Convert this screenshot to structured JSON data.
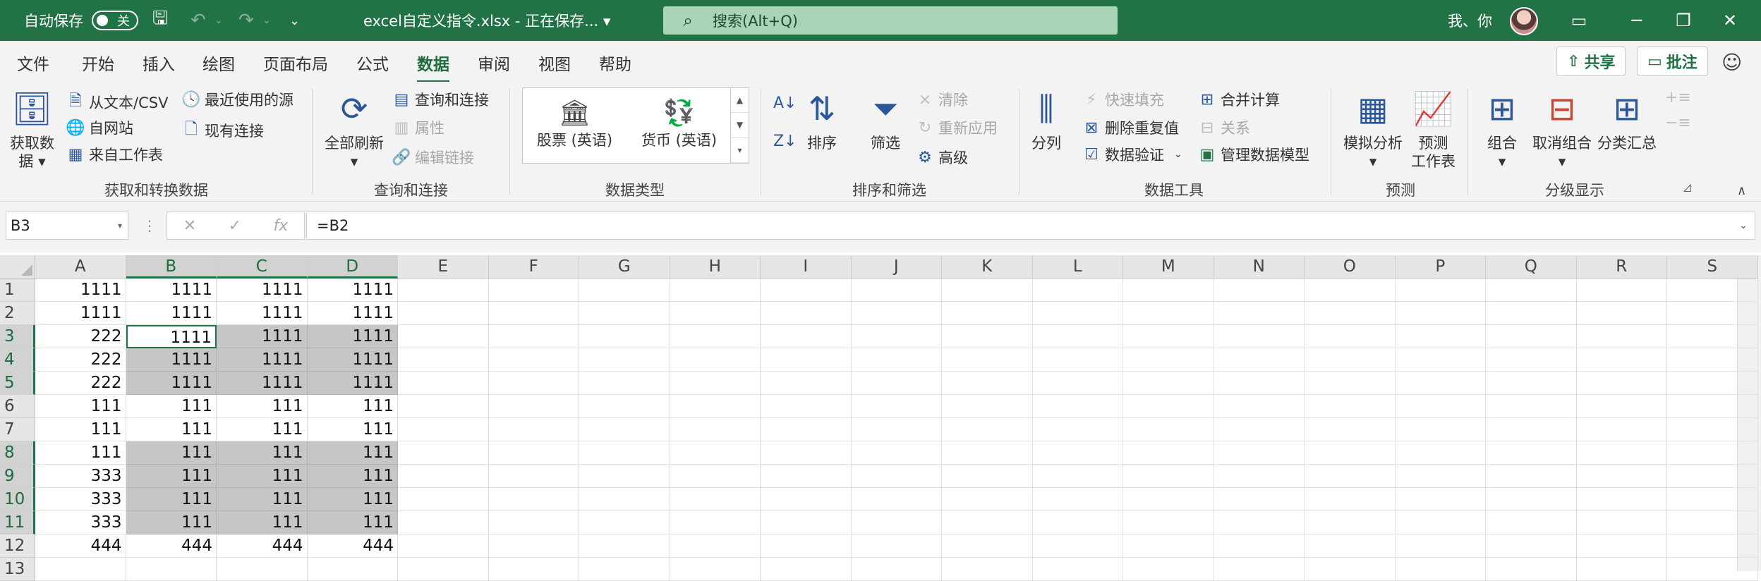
{
  "title_bar": {
    "autosave_label": "自动保存",
    "autosave_state": "关",
    "doc_title": "excel自定义指令.xlsx - 正在保存... ▾",
    "search_placeholder": "搜索(Alt+Q)",
    "user_name": "我、你",
    "bg_color": "#217346"
  },
  "menu": {
    "tabs": [
      "文件",
      "开始",
      "插入",
      "绘图",
      "页面布局",
      "公式",
      "数据",
      "审阅",
      "视图",
      "帮助"
    ],
    "active_tab": "数据",
    "share_label": "共享",
    "comment_label": "批注"
  },
  "ribbon": {
    "get_data": {
      "label_line1": "获取数",
      "label_line2": "据 ▾"
    },
    "from_text_csv": "从文本/CSV",
    "from_web": "自网站",
    "from_table": "来自工作表",
    "recent_sources": "最近使用的源",
    "existing_connections": "现有连接",
    "group_get_transform": "获取和转换数据",
    "refresh_all_line1": "全部刷新",
    "refresh_all_line2": "▾",
    "queries_connections": "查询和连接",
    "properties": "属性",
    "edit_links": "编辑链接",
    "group_queries": "查询和连接",
    "stocks": "股票 (英语)",
    "currencies": "货币 (英语)",
    "group_data_types": "数据类型",
    "sort": "排序",
    "filter": "筛选",
    "clear": "清除",
    "reapply": "重新应用",
    "advanced": "高级",
    "group_sort_filter": "排序和筛选",
    "text_to_columns": "分列",
    "flash_fill": "快速填充",
    "remove_duplicates": "删除重复值",
    "data_validation": "数据验证",
    "consolidate": "合并计算",
    "relationships": "关系",
    "manage_data_model": "管理数据模型",
    "group_data_tools": "数据工具",
    "what_if": "模拟分析",
    "what_if_arrow": "▾",
    "forecast_sheet_line1": "预测",
    "forecast_sheet_line2": "工作表",
    "group_forecast": "预测",
    "group_btn": "组合",
    "ungroup_btn": "取消组合",
    "subtotal_btn": "分类汇总",
    "group_outline": "分级显示"
  },
  "formula_bar": {
    "name_box": "B3",
    "formula": "=B2"
  },
  "sheet": {
    "columns": [
      "A",
      "B",
      "C",
      "D",
      "E",
      "F",
      "G",
      "H",
      "I",
      "J",
      "K",
      "L",
      "M",
      "N",
      "O",
      "P",
      "Q",
      "R",
      "S"
    ],
    "selected_columns": [
      "B",
      "C",
      "D"
    ],
    "selected_rows": [
      3,
      4,
      5,
      8,
      9,
      10,
      11
    ],
    "active_cell": "B3",
    "rows": [
      {
        "n": "1",
        "cells": [
          "1111",
          "1111",
          "1111",
          "1111"
        ]
      },
      {
        "n": "2",
        "cells": [
          "1111",
          "1111",
          "1111",
          "1111"
        ]
      },
      {
        "n": "3",
        "cells": [
          "222",
          "1111",
          "1111",
          "1111"
        ]
      },
      {
        "n": "4",
        "cells": [
          "222",
          "1111",
          "1111",
          "1111"
        ]
      },
      {
        "n": "5",
        "cells": [
          "222",
          "1111",
          "1111",
          "1111"
        ]
      },
      {
        "n": "6",
        "cells": [
          "111",
          "111",
          "111",
          "111"
        ]
      },
      {
        "n": "7",
        "cells": [
          "111",
          "111",
          "111",
          "111"
        ]
      },
      {
        "n": "8",
        "cells": [
          "111",
          "111",
          "111",
          "111"
        ]
      },
      {
        "n": "9",
        "cells": [
          "333",
          "111",
          "111",
          "111"
        ]
      },
      {
        "n": "10",
        "cells": [
          "333",
          "111",
          "111",
          "111"
        ]
      },
      {
        "n": "11",
        "cells": [
          "333",
          "111",
          "111",
          "111"
        ]
      },
      {
        "n": "12",
        "cells": [
          "444",
          "444",
          "444",
          "444"
        ]
      },
      {
        "n": "13",
        "cells": [
          "",
          "",
          "",
          ""
        ]
      }
    ]
  }
}
